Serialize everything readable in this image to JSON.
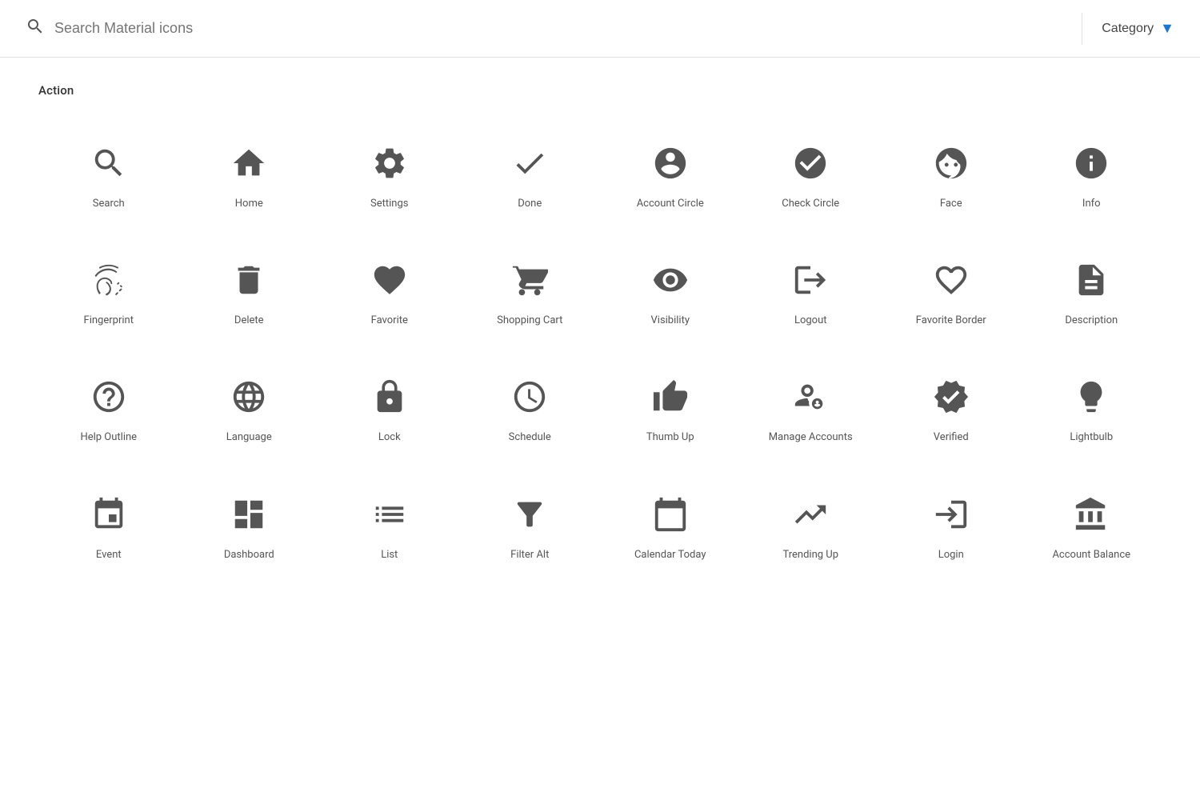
{
  "header": {
    "search_placeholder": "Search Material icons",
    "category_label": "Category"
  },
  "section": {
    "title": "Action"
  },
  "icons": [
    {
      "id": "search",
      "label": "Search",
      "row": 1
    },
    {
      "id": "home",
      "label": "Home",
      "row": 1
    },
    {
      "id": "settings",
      "label": "Settings",
      "row": 1
    },
    {
      "id": "done",
      "label": "Done",
      "row": 1
    },
    {
      "id": "account_circle",
      "label": "Account Circle",
      "row": 1
    },
    {
      "id": "check_circle",
      "label": "Check Circle",
      "row": 1
    },
    {
      "id": "face",
      "label": "Face",
      "row": 1
    },
    {
      "id": "info",
      "label": "Info",
      "row": 1
    },
    {
      "id": "fingerprint",
      "label": "Fingerprint",
      "row": 2
    },
    {
      "id": "delete",
      "label": "Delete",
      "row": 2
    },
    {
      "id": "favorite",
      "label": "Favorite",
      "row": 2
    },
    {
      "id": "shopping_cart",
      "label": "Shopping Cart",
      "row": 2
    },
    {
      "id": "visibility",
      "label": "Visibility",
      "row": 2
    },
    {
      "id": "logout",
      "label": "Logout",
      "row": 2
    },
    {
      "id": "favorite_border",
      "label": "Favorite Border",
      "row": 2
    },
    {
      "id": "description",
      "label": "Description",
      "row": 2
    },
    {
      "id": "help_outline",
      "label": "Help Outline",
      "row": 3
    },
    {
      "id": "language",
      "label": "Language",
      "row": 3
    },
    {
      "id": "lock",
      "label": "Lock",
      "row": 3
    },
    {
      "id": "schedule",
      "label": "Schedule",
      "row": 3
    },
    {
      "id": "thumb_up",
      "label": "Thumb Up",
      "row": 3
    },
    {
      "id": "manage_accounts",
      "label": "Manage Accounts",
      "row": 3
    },
    {
      "id": "verified",
      "label": "Verified",
      "row": 3
    },
    {
      "id": "lightbulb",
      "label": "Lightbulb",
      "row": 3
    },
    {
      "id": "event",
      "label": "Event",
      "row": 4
    },
    {
      "id": "dashboard",
      "label": "Dashboard",
      "row": 4
    },
    {
      "id": "list",
      "label": "List",
      "row": 4
    },
    {
      "id": "filter_alt",
      "label": "Filter Alt",
      "row": 4
    },
    {
      "id": "calendar_today",
      "label": "Calendar Today",
      "row": 4
    },
    {
      "id": "trending_up",
      "label": "Trending Up",
      "row": 4
    },
    {
      "id": "login",
      "label": "Login",
      "row": 4
    },
    {
      "id": "account_balance",
      "label": "Account Balance",
      "row": 4
    }
  ]
}
